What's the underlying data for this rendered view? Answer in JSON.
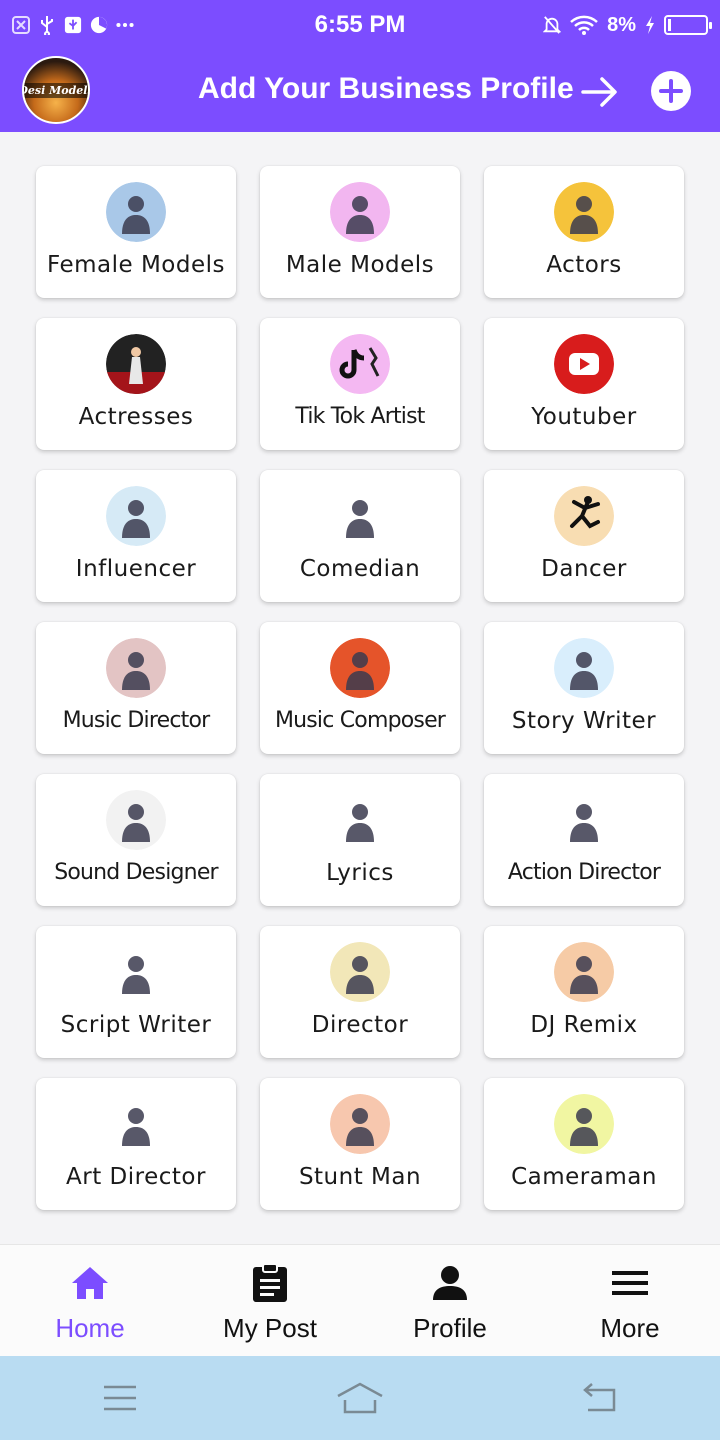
{
  "status_bar": {
    "time": "6:55 PM",
    "battery_percent": "8%",
    "battery_level": 0.08,
    "left_icons": [
      "close-box-icon",
      "usb-icon",
      "usb-debug-icon",
      "chart-icon",
      "more-dots-icon"
    ],
    "right_icons": [
      "bell-off-icon",
      "wifi-icon",
      "charging-icon",
      "battery-icon"
    ]
  },
  "header": {
    "logo_text": "Desi Models",
    "title": "Add Your Business Profile",
    "accent_color": "#7c4dff"
  },
  "categories": [
    {
      "label": "Female Models",
      "icon": "female-models-icon",
      "color": "#a9c8e8"
    },
    {
      "label": "Male Models",
      "icon": "male-models-icon",
      "color": "#f2b6f0"
    },
    {
      "label": "Actors",
      "icon": "actors-icon",
      "color": "#f5c33b"
    },
    {
      "label": "Actresses",
      "icon": "actresses-icon",
      "color": "#a4141a"
    },
    {
      "label": "Tik Tok Artist",
      "icon": "tiktok-icon",
      "color": "#f4b8f2"
    },
    {
      "label": "Youtuber",
      "icon": "youtube-icon",
      "color": "#d81c1c"
    },
    {
      "label": "Influencer",
      "icon": "influencer-icon",
      "color": "#d6eaf6"
    },
    {
      "label": "Comedian",
      "icon": "comedian-icon",
      "color": "#ffffff"
    },
    {
      "label": "Dancer",
      "icon": "dancer-icon",
      "color": "#f8ddb2"
    },
    {
      "label": "Music Director",
      "icon": "music-director-icon",
      "color": "#e3c4c4"
    },
    {
      "label": "Music Composer",
      "icon": "music-composer-icon",
      "color": "#e5542a"
    },
    {
      "label": "Story Writer",
      "icon": "story-writer-icon",
      "color": "#d9eefc"
    },
    {
      "label": "Sound Designer",
      "icon": "sound-designer-icon",
      "color": "#f2f2f2"
    },
    {
      "label": "Lyrics",
      "icon": "lyrics-icon",
      "color": "#ffffff"
    },
    {
      "label": "Action Director",
      "icon": "action-director-icon",
      "color": "#ffffff"
    },
    {
      "label": "Script Writer",
      "icon": "script-writer-icon",
      "color": "#ffffff"
    },
    {
      "label": "Director",
      "icon": "director-icon",
      "color": "#f2e7b8"
    },
    {
      "label": "DJ Remix",
      "icon": "dj-remix-icon",
      "color": "#f6cba6"
    },
    {
      "label": "Art Director",
      "icon": "art-director-icon",
      "color": "#ffffff"
    },
    {
      "label": "Stunt Man",
      "icon": "stunt-man-icon",
      "color": "#f7c7ae"
    },
    {
      "label": "Cameraman",
      "icon": "cameraman-icon",
      "color": "#f1f6a2"
    }
  ],
  "bottom_nav": [
    {
      "label": "Home",
      "icon": "home-icon",
      "active": true
    },
    {
      "label": "My Post",
      "icon": "clipboard-icon",
      "active": false
    },
    {
      "label": "Profile",
      "icon": "person-icon",
      "active": false
    },
    {
      "label": "More",
      "icon": "menu-icon",
      "active": false
    }
  ],
  "system_nav": [
    "recents-icon",
    "home-outline-icon",
    "back-icon"
  ]
}
